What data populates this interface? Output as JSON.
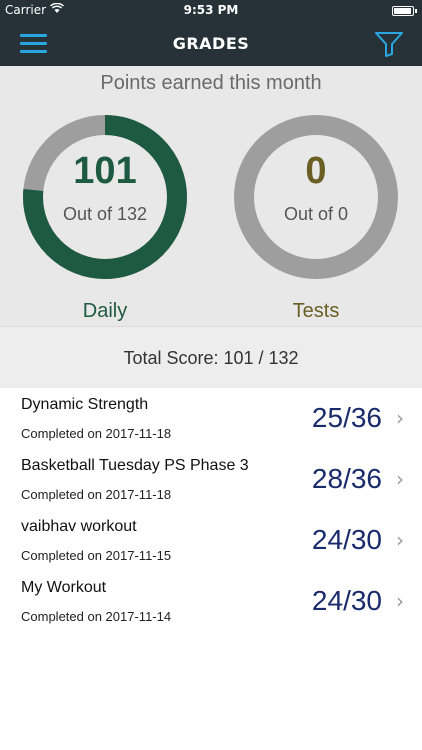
{
  "status_bar": {
    "carrier": "Carrier",
    "time": "9:53 PM"
  },
  "nav": {
    "title": "GRADES",
    "accent_color": "#2aa7e0"
  },
  "summary": {
    "heading": "Points earned this month",
    "daily": {
      "value": "101",
      "out_of": "Out of 132",
      "label": "Daily",
      "earned": 101,
      "total": 132,
      "color": "#1e5a41"
    },
    "tests": {
      "value": "0",
      "out_of": "Out of 0",
      "label": "Tests",
      "earned": 0,
      "total": 0,
      "color": "#6b5e25"
    }
  },
  "total_score": "Total Score: 101 / 132",
  "workouts": [
    {
      "name": "Dynamic Strength",
      "completed": "Completed on 2017-11-18",
      "score": "25/36"
    },
    {
      "name": "Basketball Tuesday PS Phase 3",
      "completed": "Completed on 2017-11-18",
      "score": "28/36"
    },
    {
      "name": "vaibhav workout",
      "completed": "Completed on 2017-11-15",
      "score": "24/30"
    },
    {
      "name": "My Workout",
      "completed": "Completed on 2017-11-14",
      "score": "24/30"
    }
  ]
}
